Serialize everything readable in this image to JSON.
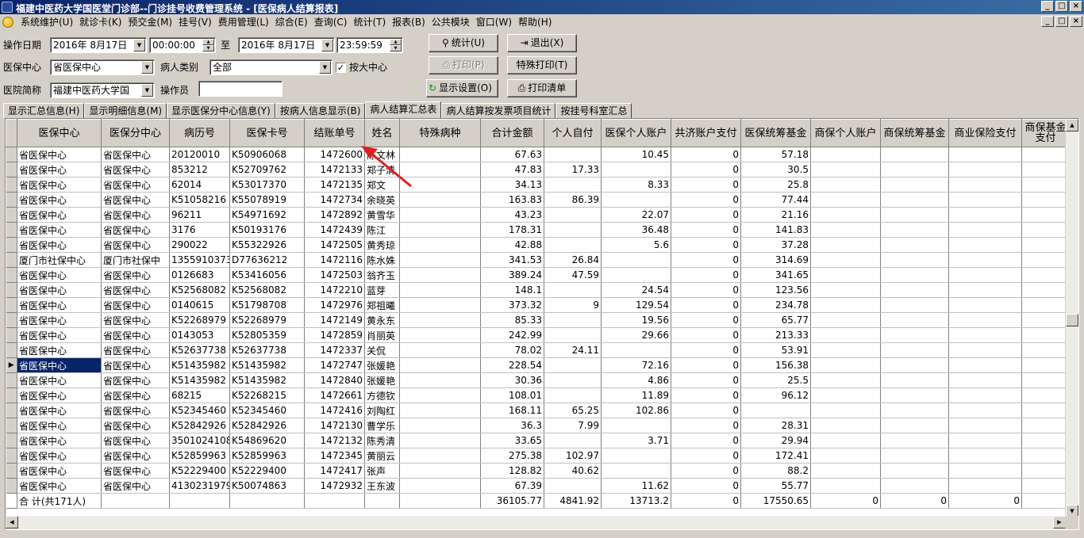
{
  "window": {
    "title": "福建中医药大学国医堂门诊部--门诊挂号收费管理系统 - [医保病人结算报表]",
    "buttons": [
      "_",
      "□",
      "×"
    ]
  },
  "menu": {
    "items": [
      "系统维护(U)",
      "就诊卡(K)",
      "预交金(M)",
      "挂号(V)",
      "费用管理(L)",
      "综合(E)",
      "查询(C)",
      "统计(T)",
      "报表(B)",
      "公共模块",
      "窗口(W)",
      "帮助(H)"
    ],
    "mdi_buttons": [
      "_",
      "□",
      "×"
    ]
  },
  "filters": {
    "date_label": "操作日期",
    "start_date": "2016年 8月17日",
    "start_time": "00:00:00",
    "to_label": "至",
    "end_date": "2016年 8月17日",
    "end_time": "23:59:59",
    "center_label": "医保中心",
    "center_value": "省医保中心",
    "patient_type_label": "病人类别",
    "patient_type_value": "全部",
    "by_center_label": "按大中心",
    "by_center_checked": "✓",
    "hospital_label": "医院简称",
    "hospital_value": "福建中医药大学国",
    "operator_label": "操作员",
    "operator_value": ""
  },
  "actions": {
    "stat": "统计(U)",
    "exit": "退出(X)",
    "print": "打印(P)",
    "special_print": "特殊打印(T)",
    "display_settings": "显示设置(O)",
    "print_list": "打印清单"
  },
  "tabs": [
    "显示汇总信息(H)",
    "显示明细信息(M)",
    "显示医保分中心信息(Y)",
    "按病人信息显示(B)",
    "病人结算汇总表",
    "病人结算按发票项目统计",
    "按挂号科室汇总"
  ],
  "active_tab": 4,
  "grid": {
    "columns": [
      "医保中心",
      "医保分中心",
      "病历号",
      "医保卡号",
      "结账单号",
      "姓名",
      "特殊病种",
      "合计金额",
      "个人自付",
      "医保个人账户",
      "共济账户支付",
      "医保统筹基金",
      "商保个人账户",
      "商保统筹基金",
      "商业保险支付",
      "商保基金支付"
    ],
    "rows": [
      [
        "省医保中心",
        "省医保中心",
        "20120010",
        "K50906068",
        "1472600",
        "陈文林",
        "",
        "67.63",
        "",
        "10.45",
        "0",
        "57.18",
        "",
        "",
        "",
        ""
      ],
      [
        "省医保中心",
        "省医保中心",
        "853212",
        "K52709762",
        "1472133",
        "郑子清",
        "",
        "47.83",
        "17.33",
        "",
        "0",
        "30.5",
        "",
        "",
        "",
        ""
      ],
      [
        "省医保中心",
        "省医保中心",
        "62014",
        "K53017370",
        "1472135",
        "郑文",
        "",
        "34.13",
        "",
        "8.33",
        "0",
        "25.8",
        "",
        "",
        "",
        ""
      ],
      [
        "省医保中心",
        "省医保中心",
        "K51058216",
        "K55078919",
        "1472734",
        "余晓英",
        "",
        "163.83",
        "86.39",
        "",
        "0",
        "77.44",
        "",
        "",
        "",
        ""
      ],
      [
        "省医保中心",
        "省医保中心",
        "96211",
        "K54971692",
        "1472892",
        "黄雪华",
        "",
        "43.23",
        "",
        "22.07",
        "0",
        "21.16",
        "",
        "",
        "",
        ""
      ],
      [
        "省医保中心",
        "省医保中心",
        "3176",
        "K50193176",
        "1472439",
        "陈江",
        "",
        "178.31",
        "",
        "36.48",
        "0",
        "141.83",
        "",
        "",
        "",
        ""
      ],
      [
        "省医保中心",
        "省医保中心",
        "290022",
        "K55322926",
        "1472505",
        "黄秀琼",
        "",
        "42.88",
        "",
        "5.6",
        "0",
        "37.28",
        "",
        "",
        "",
        ""
      ],
      [
        "厦门市社保中心",
        "厦门市社保中",
        "1355910373",
        "D77636212",
        "1472116",
        "陈水姝",
        "",
        "341.53",
        "26.84",
        "",
        "0",
        "314.69",
        "",
        "",
        "",
        ""
      ],
      [
        "省医保中心",
        "省医保中心",
        "0126683",
        "K53416056",
        "1472503",
        "翁齐玉",
        "",
        "389.24",
        "47.59",
        "",
        "0",
        "341.65",
        "",
        "",
        "",
        ""
      ],
      [
        "省医保中心",
        "省医保中心",
        "K52568082",
        "K52568082",
        "1472210",
        "蓝芽",
        "",
        "148.1",
        "",
        "24.54",
        "0",
        "123.56",
        "",
        "",
        "",
        ""
      ],
      [
        "省医保中心",
        "省医保中心",
        "0140615",
        "K51798708",
        "1472976",
        "郑祖曦",
        "",
        "373.32",
        "9",
        "129.54",
        "0",
        "234.78",
        "",
        "",
        "",
        ""
      ],
      [
        "省医保中心",
        "省医保中心",
        "K52268979",
        "K52268979",
        "1472149",
        "黄永东",
        "",
        "85.33",
        "",
        "19.56",
        "0",
        "65.77",
        "",
        "",
        "",
        ""
      ],
      [
        "省医保中心",
        "省医保中心",
        "0143053",
        "K52805359",
        "1472859",
        "肖丽英",
        "",
        "242.99",
        "",
        "29.66",
        "0",
        "213.33",
        "",
        "",
        "",
        ""
      ],
      [
        "省医保中心",
        "省医保中心",
        "K52637738",
        "K52637738",
        "1472337",
        "关侃",
        "",
        "78.02",
        "24.11",
        "",
        "0",
        "53.91",
        "",
        "",
        "",
        ""
      ],
      [
        "省医保中心",
        "省医保中心",
        "K51435982",
        "K51435982",
        "1472747",
        "张媛艳",
        "",
        "228.54",
        "",
        "72.16",
        "0",
        "156.38",
        "",
        "",
        "",
        ""
      ],
      [
        "省医保中心",
        "省医保中心",
        "K51435982",
        "K51435982",
        "1472840",
        "张媛艳",
        "",
        "30.36",
        "",
        "4.86",
        "0",
        "25.5",
        "",
        "",
        "",
        ""
      ],
      [
        "省医保中心",
        "省医保中心",
        "68215",
        "K52268215",
        "1472661",
        "方德钦",
        "",
        "108.01",
        "",
        "11.89",
        "0",
        "96.12",
        "",
        "",
        "",
        ""
      ],
      [
        "省医保中心",
        "省医保中心",
        "K52345460",
        "K52345460",
        "1472416",
        "刘陶红",
        "",
        "168.11",
        "65.25",
        "102.86",
        "0",
        "",
        "",
        "",
        "",
        ""
      ],
      [
        "省医保中心",
        "省医保中心",
        "K52842926",
        "K52842926",
        "1472130",
        "曹学乐",
        "",
        "36.3",
        "7.99",
        "",
        "0",
        "28.31",
        "",
        "",
        "",
        ""
      ],
      [
        "省医保中心",
        "省医保中心",
        "3501024108",
        "K54869620",
        "1472132",
        "陈秀清",
        "",
        "33.65",
        "",
        "3.71",
        "0",
        "29.94",
        "",
        "",
        "",
        ""
      ],
      [
        "省医保中心",
        "省医保中心",
        "K52859963",
        "K52859963",
        "1472345",
        "黄丽云",
        "",
        "275.38",
        "102.97",
        "",
        "0",
        "172.41",
        "",
        "",
        "",
        ""
      ],
      [
        "省医保中心",
        "省医保中心",
        "K52229400",
        "K52229400",
        "1472417",
        "张声",
        "",
        "128.82",
        "40.62",
        "",
        "0",
        "88.2",
        "",
        "",
        "",
        ""
      ],
      [
        "省医保中心",
        "省医保中心",
        "4130231979",
        "K50074863",
        "1472932",
        "王东波",
        "",
        "67.39",
        "",
        "11.62",
        "0",
        "55.77",
        "",
        "",
        "",
        ""
      ]
    ],
    "selected_row": 14,
    "row_marker": "▶",
    "total_row": [
      "合 计(共171人)",
      "",
      "",
      "",
      "",
      "",
      "",
      "36105.77",
      "4841.92",
      "13713.2",
      "0",
      "17550.65",
      "0",
      "0",
      "0",
      ""
    ]
  },
  "colors": {
    "annotation_arrow": "#e02020",
    "selection": "#0a246a",
    "titlebar_start": "#0a246a",
    "titlebar_end": "#3a6ea5"
  }
}
